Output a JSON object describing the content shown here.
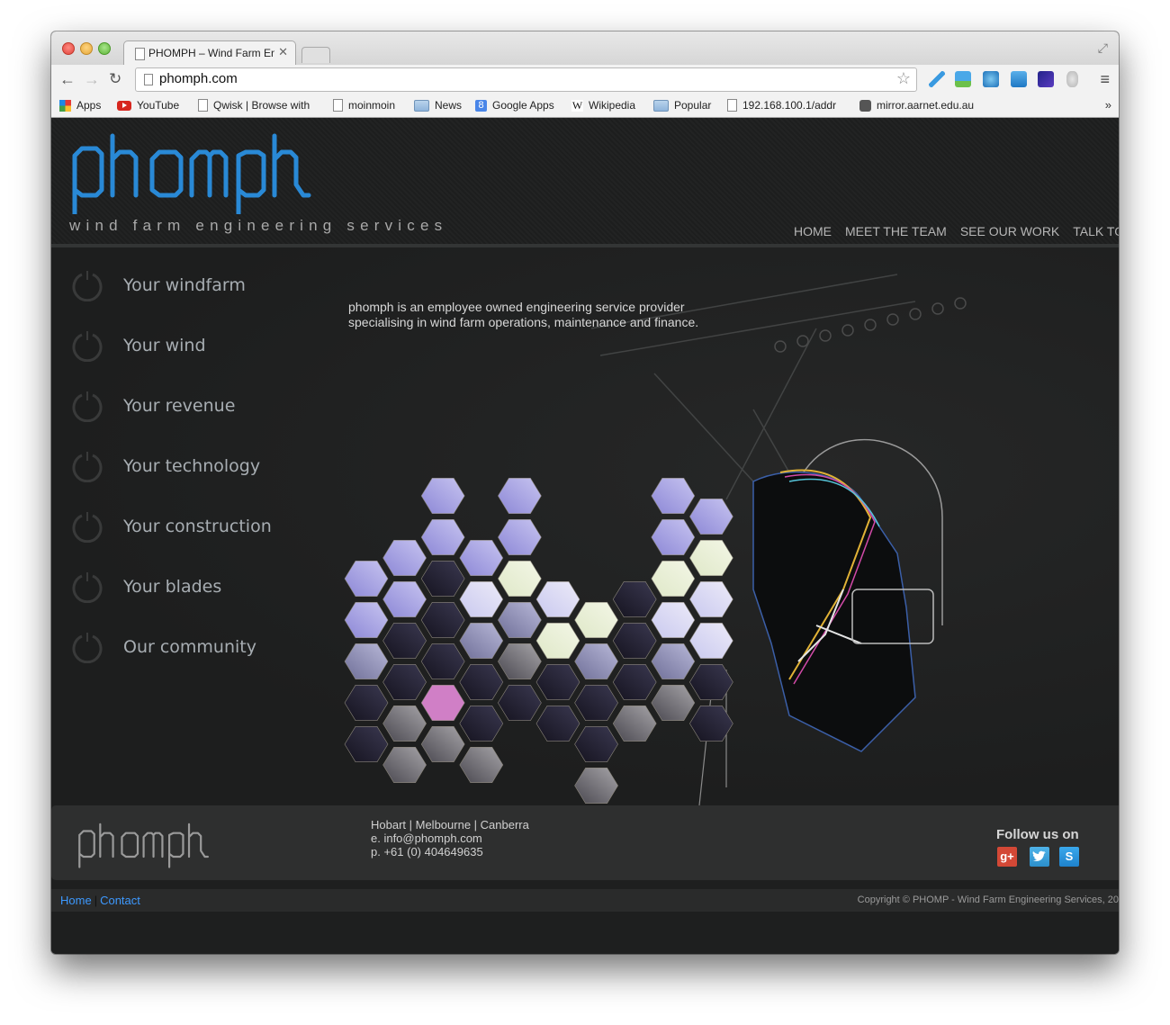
{
  "browser": {
    "tab_title": "PHOMPH – Wind Farm Engi",
    "url": "phomph.com",
    "bookmarks": [
      {
        "label": "Apps",
        "icon": "apps-grid-icon"
      },
      {
        "label": "YouTube",
        "icon": "youtube-icon"
      },
      {
        "label": "Qwisk | Browse with",
        "icon": "document-icon"
      },
      {
        "label": "moinmoin",
        "icon": "document-icon"
      },
      {
        "label": "News",
        "icon": "folder-icon"
      },
      {
        "label": "Google Apps",
        "icon": "google-icon"
      },
      {
        "label": "Wikipedia",
        "icon": "wikipedia-icon"
      },
      {
        "label": "Popular",
        "icon": "folder-icon"
      },
      {
        "label": "192.168.100.1/addr",
        "icon": "document-icon"
      },
      {
        "label": "mirror.aarnet.edu.au",
        "icon": "mirror-icon"
      }
    ],
    "more_bookmarks": "»"
  },
  "header": {
    "logo_text": "phomph",
    "logo_color": "#2a8fe0",
    "tagline": "wind farm engineering services",
    "nav": [
      "HOME",
      "MEET THE TEAM",
      "SEE OUR WORK",
      "TALK TO US"
    ]
  },
  "sidebar": {
    "items": [
      {
        "label": "Your windfarm"
      },
      {
        "label": "Your wind"
      },
      {
        "label": "Your revenue"
      },
      {
        "label": "Your technology"
      },
      {
        "label": "Your construction"
      },
      {
        "label": "Your blades"
      },
      {
        "label": "Our community"
      }
    ]
  },
  "intro": {
    "text": "phomph is an employee owned engineering service provider specialising in wind farm operations, maintenance and finance."
  },
  "hex_mosaic": {
    "highlight_color": "#d07fc6",
    "columns": [
      {
        "start": 1,
        "tones": [
          "lilac",
          "lilac",
          "steel",
          "dark",
          "dark"
        ]
      },
      {
        "start": 0,
        "tones": [
          "lilac",
          "lilac",
          "dark",
          "dark",
          "grey",
          "grey"
        ]
      },
      {
        "start": -1,
        "tones": [
          "lilac",
          "lilac",
          "dark",
          "dark",
          "dark",
          "highlight",
          "grey"
        ]
      },
      {
        "start": 0,
        "tones": [
          "lilac",
          "pale",
          "steel",
          "dark",
          "dark",
          "grey"
        ]
      },
      {
        "start": -1,
        "tones": [
          "lilac",
          "lilac",
          "ruler",
          "steel",
          "grey",
          "dark"
        ]
      },
      {
        "start": 1,
        "tones": [
          "pale",
          "ruler",
          "dark",
          "dark"
        ]
      },
      {
        "start": 2,
        "tones": [
          "ruler",
          "steel",
          "dark",
          "dark",
          "grey"
        ]
      },
      {
        "start": 1,
        "tones": [
          "dark",
          "dark",
          "dark",
          "grey"
        ]
      },
      {
        "start": -1,
        "tones": [
          "lilac",
          "lilac",
          "ruler",
          "pale",
          "steel",
          "grey"
        ]
      },
      {
        "start": -1,
        "tones": [
          "lilac",
          "ruler",
          "pale",
          "pale",
          "dark",
          "dark"
        ]
      }
    ]
  },
  "footer": {
    "logo_text": "phomph",
    "locations": "Hobart | Melbourne | Canberra",
    "email": "e. info@phomph.com",
    "phone": "p. +61 (0) 404649635",
    "follow_label": "Follow us on",
    "social": [
      {
        "name": "Google+",
        "glyph": "g+"
      },
      {
        "name": "Twitter",
        "glyph": "t"
      },
      {
        "name": "Skype",
        "glyph": "S"
      }
    ]
  },
  "bottom": {
    "links": [
      "Home",
      "Contact"
    ],
    "copyright": "Copyright © PHOMP - Wind Farm Engineering Services, 20"
  }
}
